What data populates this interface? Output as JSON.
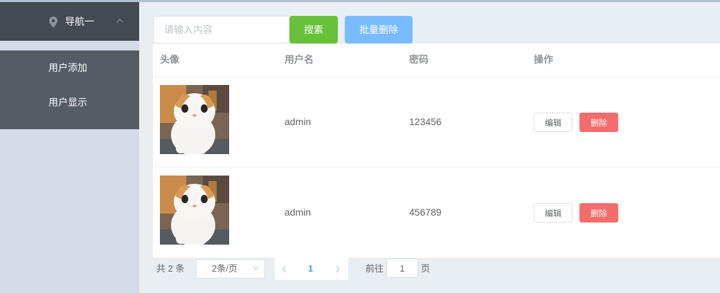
{
  "sidebar": {
    "submenu_title": "导航一",
    "items": [
      {
        "label": "用户添加"
      },
      {
        "label": "用户显示"
      }
    ]
  },
  "toolbar": {
    "search_placeholder": "请输入内容",
    "search_button": "搜素",
    "batch_delete_button": "批量删除"
  },
  "table": {
    "headers": [
      "头像",
      "用户名",
      "密码",
      "操作"
    ],
    "rows": [
      {
        "username": "admin",
        "password": "123456",
        "edit_label": "编辑",
        "delete_label": "删除"
      },
      {
        "username": "admin",
        "password": "456789",
        "edit_label": "编辑",
        "delete_label": "删除"
      }
    ]
  },
  "pagination": {
    "total_text": "共 2 条",
    "page_size": "2条/页",
    "current_page": "1",
    "goto_prefix": "前往",
    "goto_value": "1",
    "goto_suffix": "页"
  },
  "icons": {
    "submenu": "location-pin-icon",
    "submenu_toggle": "chevron-up-icon",
    "page_size": "chevron-down-icon",
    "prev": "chevron-left-icon",
    "next": "chevron-right-icon"
  },
  "colors": {
    "sidebar_bg": "#d3dce6",
    "menu_bg": "#545c64",
    "submenu_title_bg": "#434a50",
    "main_bg": "#e9eef3",
    "search_button": "#67c23a",
    "batch_button": "#79bbff",
    "delete_button": "#f56c6c",
    "active_page": "#409eff"
  }
}
